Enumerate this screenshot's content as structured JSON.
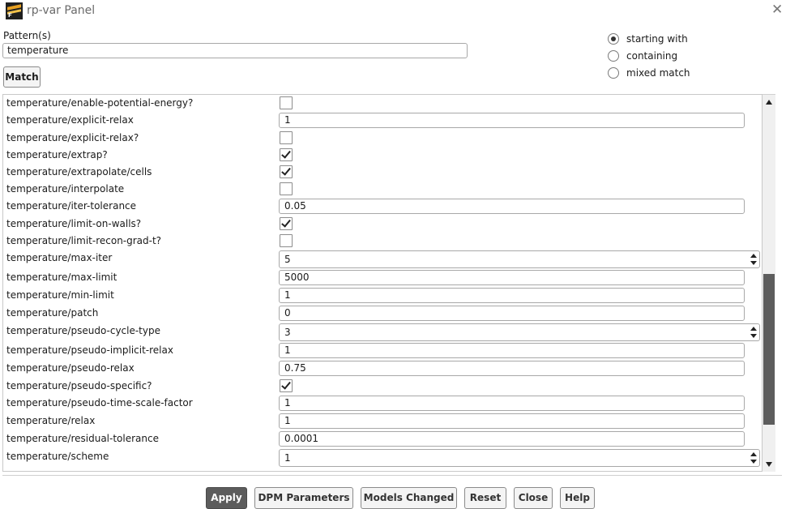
{
  "window": {
    "title": "rp-var Panel",
    "close_glyph": "✕"
  },
  "pattern": {
    "label": "Pattern(s)",
    "value": "temperature"
  },
  "match_button": "Match",
  "match_modes": [
    {
      "label": "starting with",
      "selected": true
    },
    {
      "label": "containing",
      "selected": false
    },
    {
      "label": "mixed match",
      "selected": false
    }
  ],
  "rows": [
    {
      "name": "temperature/enable-potential-energy?",
      "kind": "checkbox",
      "checked": false
    },
    {
      "name": "temperature/explicit-relax",
      "kind": "text",
      "value": "1"
    },
    {
      "name": "temperature/explicit-relax?",
      "kind": "checkbox",
      "checked": false
    },
    {
      "name": "temperature/extrap?",
      "kind": "checkbox",
      "checked": true
    },
    {
      "name": "temperature/extrapolate/cells",
      "kind": "checkbox",
      "checked": true
    },
    {
      "name": "temperature/interpolate",
      "kind": "checkbox",
      "checked": false
    },
    {
      "name": "temperature/iter-tolerance",
      "kind": "text",
      "value": "0.05"
    },
    {
      "name": "temperature/limit-on-walls?",
      "kind": "checkbox",
      "checked": true
    },
    {
      "name": "temperature/limit-recon-grad-t?",
      "kind": "checkbox",
      "checked": false
    },
    {
      "name": "temperature/max-iter",
      "kind": "spin",
      "value": "5"
    },
    {
      "name": "temperature/max-limit",
      "kind": "text",
      "value": "5000"
    },
    {
      "name": "temperature/min-limit",
      "kind": "text",
      "value": "1"
    },
    {
      "name": "temperature/patch",
      "kind": "text",
      "value": "0"
    },
    {
      "name": "temperature/pseudo-cycle-type",
      "kind": "spin",
      "value": "3"
    },
    {
      "name": "temperature/pseudo-implicit-relax",
      "kind": "text",
      "value": "1"
    },
    {
      "name": "temperature/pseudo-relax",
      "kind": "text",
      "value": "0.75"
    },
    {
      "name": "temperature/pseudo-specific?",
      "kind": "checkbox",
      "checked": true
    },
    {
      "name": "temperature/pseudo-time-scale-factor",
      "kind": "text",
      "value": "1"
    },
    {
      "name": "temperature/relax",
      "kind": "text",
      "value": "1"
    },
    {
      "name": "temperature/residual-tolerance",
      "kind": "text",
      "value": "0.0001"
    },
    {
      "name": "temperature/scheme",
      "kind": "spin",
      "value": "1"
    }
  ],
  "buttons": {
    "apply": "Apply",
    "dpm": "DPM Parameters",
    "models": "Models Changed",
    "reset": "Reset",
    "close": "Close",
    "help": "Help"
  }
}
